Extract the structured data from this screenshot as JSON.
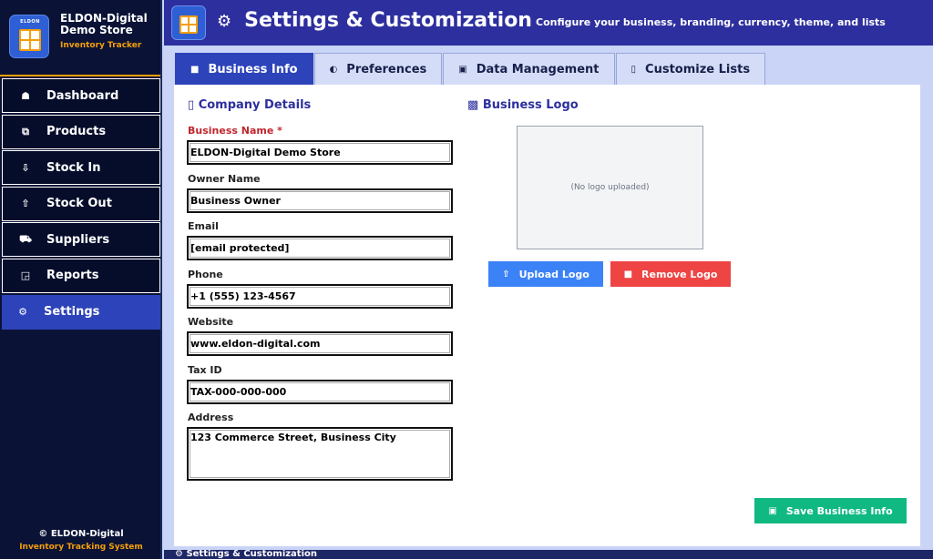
{
  "sidebar": {
    "brand_mini": "ELDON",
    "brand_name": "ELDON-Digital Demo Store",
    "brand_sub": "Inventory Tracker",
    "items": [
      {
        "label": "Dashboard",
        "icon": "home-icon",
        "glyph": "☗"
      },
      {
        "label": "Products",
        "icon": "box-icon",
        "glyph": "⧉"
      },
      {
        "label": "Stock In",
        "icon": "stock-in-icon",
        "glyph": "⇩"
      },
      {
        "label": "Stock Out",
        "icon": "stock-out-icon",
        "glyph": "⇧"
      },
      {
        "label": "Suppliers",
        "icon": "truck-icon",
        "glyph": "⛟"
      },
      {
        "label": "Reports",
        "icon": "report-icon",
        "glyph": "◲"
      },
      {
        "label": "Settings",
        "icon": "gear-icon",
        "glyph": "⚙",
        "active": true
      }
    ],
    "footer_copyright": "© ELDON-Digital",
    "footer_sub": "Inventory Tracking System"
  },
  "header": {
    "gear_glyph": "⚙",
    "title": "Settings & Customization",
    "subtitle": "Configure your business, branding, currency, theme, and lists"
  },
  "tabs": [
    {
      "label": "Business Info",
      "icon": "square-icon",
      "glyph": "■",
      "active": true
    },
    {
      "label": "Preferences",
      "icon": "palette-icon",
      "glyph": "◐"
    },
    {
      "label": "Data Management",
      "icon": "disk-icon",
      "glyph": "▣"
    },
    {
      "label": "Customize Lists",
      "icon": "clipboard-icon",
      "glyph": "▯"
    }
  ],
  "company": {
    "section_glyph": "▯",
    "section_title": "Company Details",
    "fields": {
      "business_name": {
        "label": "Business Name *",
        "value": "ELDON-Digital Demo Store"
      },
      "owner_name": {
        "label": "Owner Name",
        "value": "Business Owner"
      },
      "email": {
        "label": "Email",
        "value": "[email protected]"
      },
      "phone": {
        "label": "Phone",
        "value": "+1 (555) 123-4567"
      },
      "website": {
        "label": "Website",
        "value": "www.eldon-digital.com"
      },
      "tax_id": {
        "label": "Tax ID",
        "value": "TAX-000-000-000"
      },
      "address": {
        "label": "Address",
        "value": "123 Commerce Street, Business City"
      }
    }
  },
  "logo": {
    "section_glyph": "▩",
    "section_title": "Business Logo",
    "placeholder": "(No logo uploaded)",
    "upload_glyph": "⇧",
    "upload_label": "Upload Logo",
    "remove_glyph": "■",
    "remove_label": "Remove Logo"
  },
  "save": {
    "glyph": "▣",
    "label": "Save Business Info"
  },
  "footer_bar": {
    "text": "⚙ Settings & Customization"
  },
  "colors": {
    "sidebar_bg": "#0a1336",
    "header_bg": "#2d2f9e",
    "active_bg": "#2d43b9",
    "accent": "#f59e0b",
    "upload": "#3b82f6",
    "remove": "#ef4444",
    "save": "#10b981",
    "required": "#c0262d"
  }
}
